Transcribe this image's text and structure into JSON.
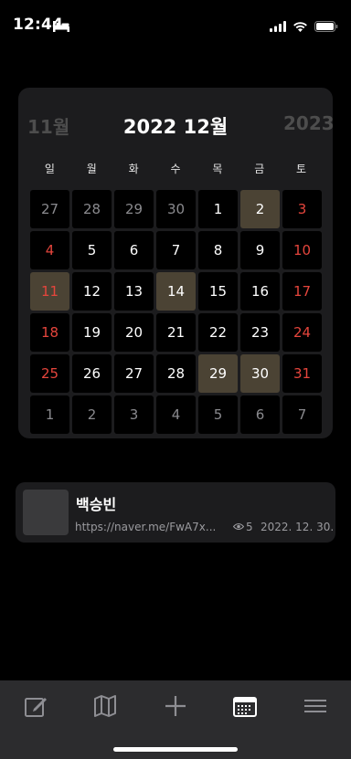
{
  "status_bar": {
    "time": "12:44",
    "icons": [
      "bed-icon",
      "cellular-signal-icon",
      "wifi-icon",
      "battery-icon"
    ]
  },
  "calendar": {
    "prev_month": "11월",
    "current_month": "2022 12월",
    "next_month": "2023",
    "weekdays": [
      "일",
      "월",
      "화",
      "수",
      "목",
      "금",
      "토"
    ],
    "days": [
      {
        "n": "27",
        "state": "muted"
      },
      {
        "n": "28",
        "state": "muted"
      },
      {
        "n": "29",
        "state": "muted"
      },
      {
        "n": "30",
        "state": "muted"
      },
      {
        "n": "1",
        "state": "normal"
      },
      {
        "n": "2",
        "state": "event"
      },
      {
        "n": "3",
        "state": "red"
      },
      {
        "n": "4",
        "state": "red"
      },
      {
        "n": "5",
        "state": "normal"
      },
      {
        "n": "6",
        "state": "normal"
      },
      {
        "n": "7",
        "state": "normal"
      },
      {
        "n": "8",
        "state": "normal"
      },
      {
        "n": "9",
        "state": "normal"
      },
      {
        "n": "10",
        "state": "red"
      },
      {
        "n": "11",
        "state": "event-red"
      },
      {
        "n": "12",
        "state": "normal"
      },
      {
        "n": "13",
        "state": "normal"
      },
      {
        "n": "14",
        "state": "event"
      },
      {
        "n": "15",
        "state": "normal"
      },
      {
        "n": "16",
        "state": "normal"
      },
      {
        "n": "17",
        "state": "red"
      },
      {
        "n": "18",
        "state": "red"
      },
      {
        "n": "19",
        "state": "normal"
      },
      {
        "n": "20",
        "state": "normal"
      },
      {
        "n": "21",
        "state": "normal"
      },
      {
        "n": "22",
        "state": "normal"
      },
      {
        "n": "23",
        "state": "normal"
      },
      {
        "n": "24",
        "state": "red"
      },
      {
        "n": "25",
        "state": "red"
      },
      {
        "n": "26",
        "state": "normal"
      },
      {
        "n": "27",
        "state": "normal"
      },
      {
        "n": "28",
        "state": "normal"
      },
      {
        "n": "29",
        "state": "event"
      },
      {
        "n": "30",
        "state": "event"
      },
      {
        "n": "31",
        "state": "red"
      },
      {
        "n": "1",
        "state": "muted"
      },
      {
        "n": "2",
        "state": "muted"
      },
      {
        "n": "3",
        "state": "muted"
      },
      {
        "n": "4",
        "state": "muted"
      },
      {
        "n": "5",
        "state": "muted"
      },
      {
        "n": "6",
        "state": "muted"
      },
      {
        "n": "7",
        "state": "muted"
      }
    ],
    "colors": {
      "event_bg": "#4b4334",
      "weekend": "#e5453c",
      "muted": "#8a8a8e"
    }
  },
  "post": {
    "title": "백승빈",
    "url": "https://naver.me/FwA7x...",
    "views": "5",
    "date": "2022. 12. 30."
  },
  "tab_bar": {
    "items": [
      {
        "name": "write-icon"
      },
      {
        "name": "map-icon"
      },
      {
        "name": "plus-icon"
      },
      {
        "name": "calendar-icon",
        "active": true
      },
      {
        "name": "menu-icon"
      }
    ]
  }
}
